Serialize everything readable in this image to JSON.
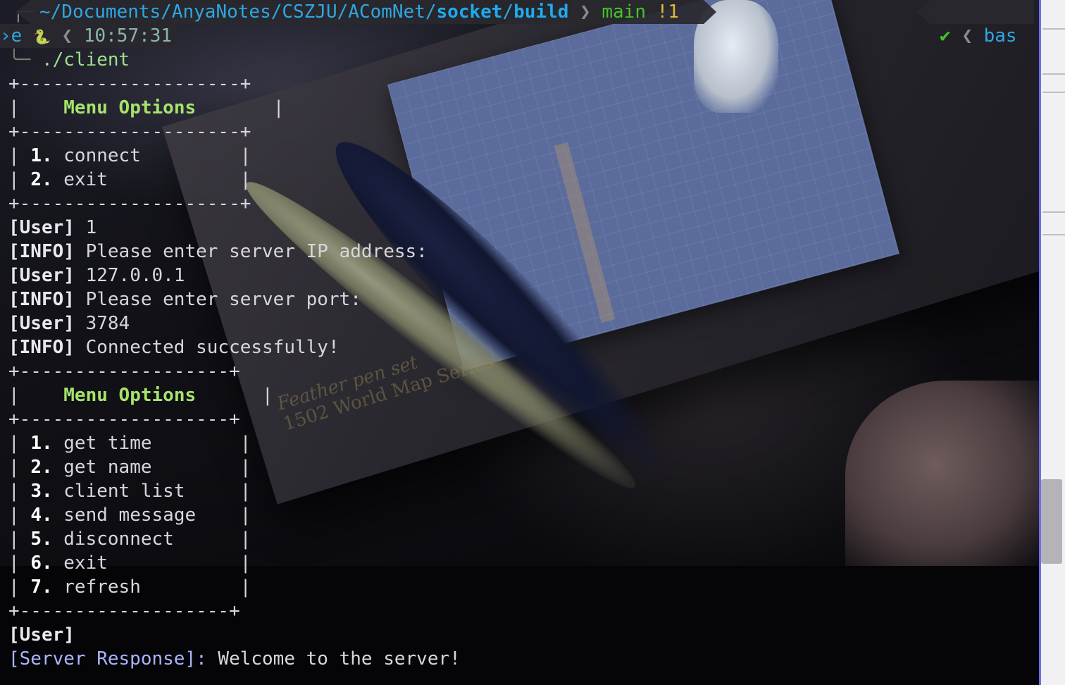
{
  "prompt": {
    "corner_glyph": "╭─",
    "path_prefix": "~/Documents/AnyaNotes/CSZJU/AComNet/",
    "path_bold": "socket",
    "path_sep": "/",
    "path_bold2": "build",
    "chevron": "❯",
    "branch": "main",
    "dirty": "!1",
    "right_check": "✔",
    "right_chev": "❮",
    "right_text": "bas",
    "line2_lead": "›e",
    "line2_py": "🐍",
    "line2_chev": "❮",
    "time": "10:57:31",
    "tree": "╰─",
    "command": "./client"
  },
  "menu1": {
    "border": "+--------------------+",
    "title": "Menu Options",
    "items": [
      {
        "num": "1.",
        "label": "connect"
      },
      {
        "num": "2.",
        "label": "exit"
      }
    ]
  },
  "log": [
    {
      "tag": "[User]",
      "text": " 1"
    },
    {
      "tag": "[INFO]",
      "text": " Please enter server IP address:"
    },
    {
      "tag": "[User]",
      "text": " 127.0.0.1"
    },
    {
      "tag": "[INFO]",
      "text": " Please enter server port:"
    },
    {
      "tag": "[User]",
      "text": " 3784"
    },
    {
      "tag": "[INFO]",
      "text": " Connected successfully!"
    }
  ],
  "menu2": {
    "border": "+-------------------+",
    "title": "Menu Options",
    "items": [
      {
        "num": "1.",
        "label": "get time"
      },
      {
        "num": "2.",
        "label": "get name"
      },
      {
        "num": "3.",
        "label": "client list"
      },
      {
        "num": "4.",
        "label": "send message"
      },
      {
        "num": "5.",
        "label": "disconnect"
      },
      {
        "num": "6.",
        "label": "exit"
      },
      {
        "num": "7.",
        "label": "refresh"
      }
    ]
  },
  "final": {
    "user_tag": "[User]",
    "server_tag": "[Server Response]:",
    "server_text": " Welcome to the server!"
  },
  "wallpaper_text": {
    "line1": "Feather pen set",
    "line2": "1502 World Map Series"
  },
  "colors": {
    "path": "#2fa6e0",
    "branch": "#42c428",
    "dirty": "#e0b93a",
    "menu_title": "#a6e36b",
    "server_tag": "#aab4ff",
    "scrollbar_accent": "#6e6cf0"
  }
}
